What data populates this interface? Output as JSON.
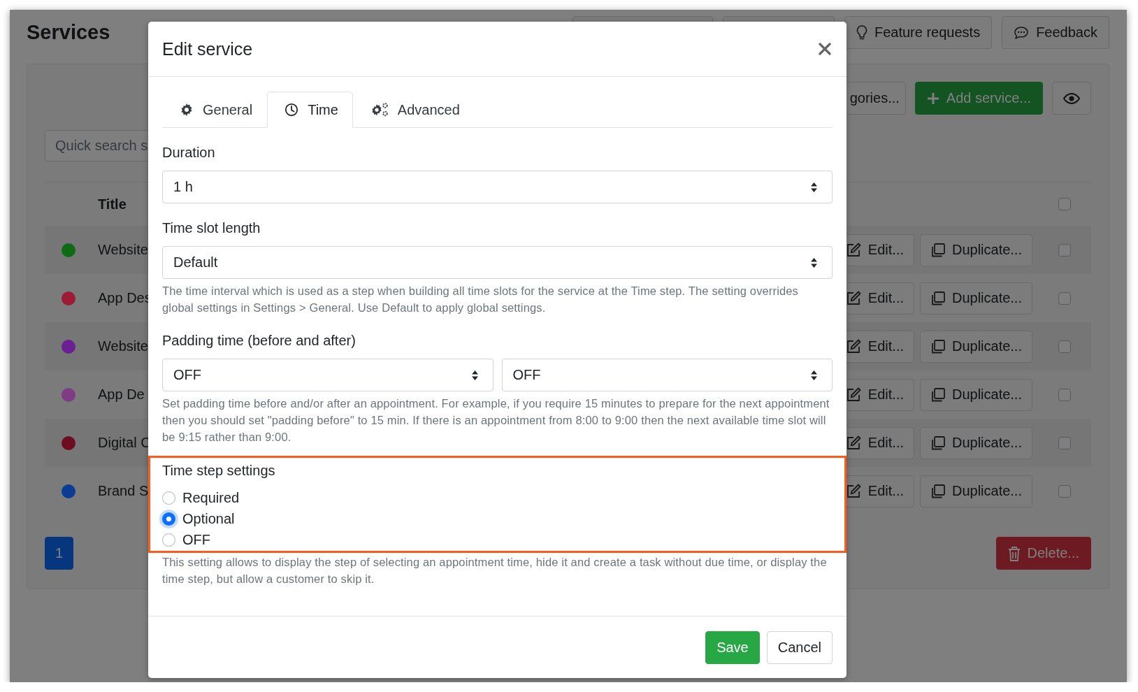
{
  "page": {
    "title": "Services",
    "header_buttons": [
      {
        "label": "Feature requests"
      },
      {
        "label": "Feedback"
      }
    ]
  },
  "toolbar": {
    "buttons": [
      {
        "kind": "plain",
        "label": "gories..."
      },
      {
        "kind": "primary",
        "label": "Add service..."
      },
      {
        "kind": "icon"
      }
    ]
  },
  "search": {
    "placeholder": "Quick search s"
  },
  "table": {
    "columns": [
      "Title"
    ],
    "header_checkbox": {
      "checked": false
    },
    "rows": [
      {
        "color": "#0e6a14",
        "title": "Website",
        "edit": "Edit...",
        "duplicate": "Duplicate...",
        "checked": false
      },
      {
        "color": "#9c1a36",
        "title": "App Des",
        "edit": "Edit...",
        "duplicate": "Duplicate...",
        "checked": false
      },
      {
        "color": "#6a2090",
        "title": "Website",
        "edit": "Edit...",
        "duplicate": "Duplicate...",
        "checked": false
      },
      {
        "color": "#7e3c82",
        "title": "App De",
        "edit": "Edit...",
        "duplicate": "Duplicate...",
        "checked": false
      },
      {
        "color": "#6e0c22",
        "title": "Digital C",
        "edit": "Edit...",
        "duplicate": "Duplicate...",
        "checked": false
      },
      {
        "color": "#0a3c92",
        "title": "Brand S",
        "edit": "Edit...",
        "duplicate": "Duplicate...",
        "checked": false
      }
    ]
  },
  "pagination": [
    {
      "label": "1",
      "selected": true
    }
  ],
  "delete_button": "Delete...",
  "modal": {
    "title": "Edit service",
    "tabs": [
      {
        "label": "General",
        "selected": false
      },
      {
        "label": "Time",
        "selected": true
      },
      {
        "label": "Advanced",
        "selected": false
      }
    ],
    "fields": [
      {
        "kind": "select",
        "label": "Duration",
        "values": [
          "1 h"
        ]
      },
      {
        "kind": "select",
        "label": "Time slot length",
        "values": [
          "Default"
        ],
        "help": "The time interval which is used as a step when building all time slots for the service at the Time step. The setting overrides global settings in Settings > General. Use Default to apply global settings."
      },
      {
        "kind": "select",
        "label": "Padding time (before and after)",
        "values": [
          "OFF",
          "OFF"
        ],
        "help": "Set padding time before and/or after an appointment. For example, if you require 15 minutes to prepare for the next appointment then you should set \"padding before\" to 15 min. If there is an appointment from 8:00 to 9:00 then the next available time slot will be 9:15 rather than 9:00."
      },
      {
        "kind": "radio",
        "label": "Time step settings",
        "highlighted": true,
        "options": [
          {
            "label": "Required",
            "selected": false
          },
          {
            "label": "Optional",
            "selected": true
          },
          {
            "label": "OFF",
            "selected": false
          }
        ],
        "help": "This setting allows to display the step of selecting an appointment time, hide it and create a task without due time, or display the time step, but allow a customer to skip it."
      }
    ],
    "buttons": [
      {
        "kind": "primary",
        "label": "Save"
      },
      {
        "kind": "secondary",
        "label": "Cancel"
      }
    ]
  }
}
